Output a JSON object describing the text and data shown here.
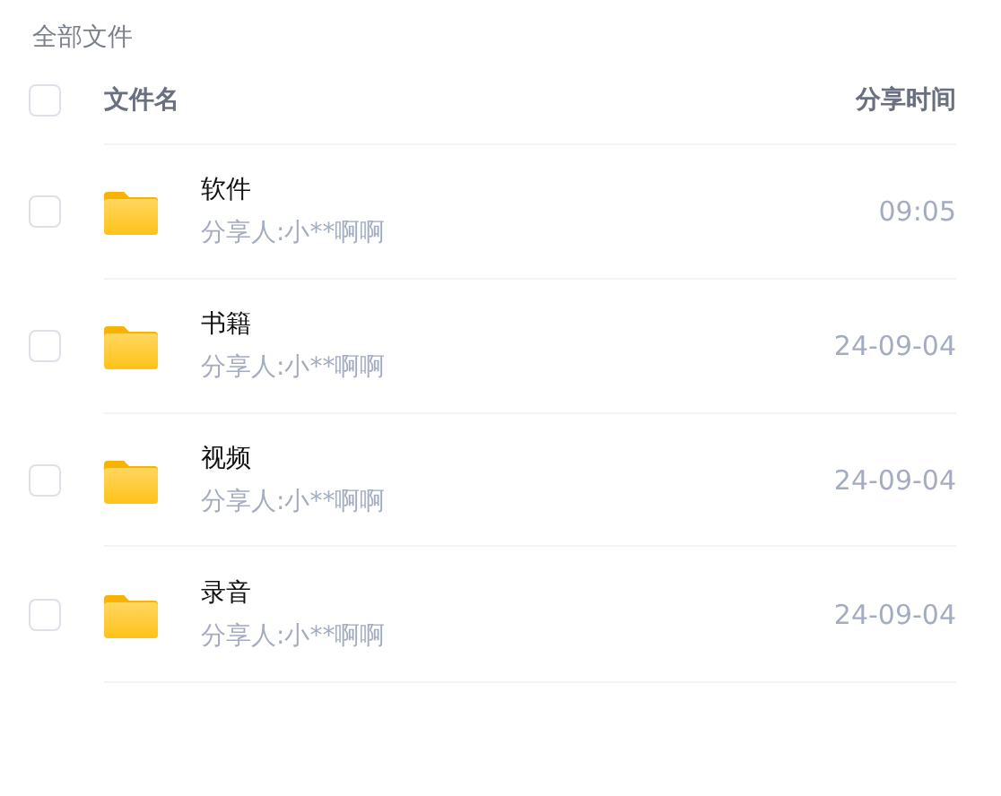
{
  "breadcrumb": "全部文件",
  "header": {
    "checked": false,
    "name_column": "文件名",
    "time_column": "分享时间"
  },
  "files": [
    {
      "name": "软件",
      "sharer": "分享人:小**啊啊",
      "time": "09:05",
      "checked": false
    },
    {
      "name": "书籍",
      "sharer": "分享人:小**啊啊",
      "time": "24-09-04",
      "checked": false
    },
    {
      "name": "视频",
      "sharer": "分享人:小**啊啊",
      "time": "24-09-04",
      "checked": false
    },
    {
      "name": "录音",
      "sharer": "分享人:小**啊啊",
      "time": "24-09-04",
      "checked": false
    }
  ]
}
